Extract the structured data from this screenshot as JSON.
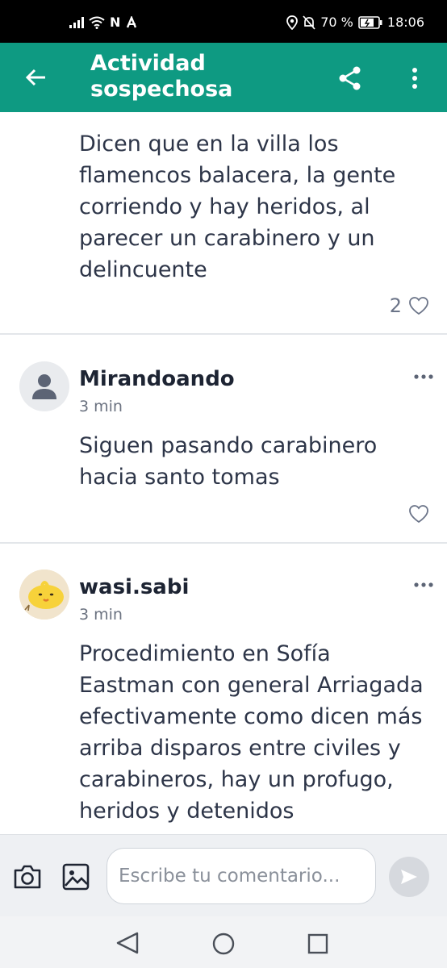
{
  "status_bar": {
    "network_label": "N",
    "battery_percent": "70 %",
    "time": "18:06"
  },
  "app_bar": {
    "title": "Actividad sospechosa",
    "accent_color": "#0e9a82"
  },
  "posts": [
    {
      "text": "Dicen que en la villa los flamencos balacera, la gente corriendo y hay heridos, al parecer un carabinero y un delincuente",
      "likes": "2"
    }
  ],
  "comments": [
    {
      "username": "Mirandoando",
      "time": "3 min",
      "text": "Siguen pasando carabinero hacia santo tomas",
      "avatar": "default-user-icon"
    },
    {
      "username": "wasi.sabi",
      "time": "3 min",
      "text": "Procedimiento en Sofía Eastman con general Arriagada efectivamente como dicen más arriba disparos entre civiles y carabineros, hay un profugo, heridos y detenidos",
      "avatar": "yellow-chick-avatar"
    }
  ],
  "composer": {
    "placeholder": "Escribe tu comentario..."
  }
}
